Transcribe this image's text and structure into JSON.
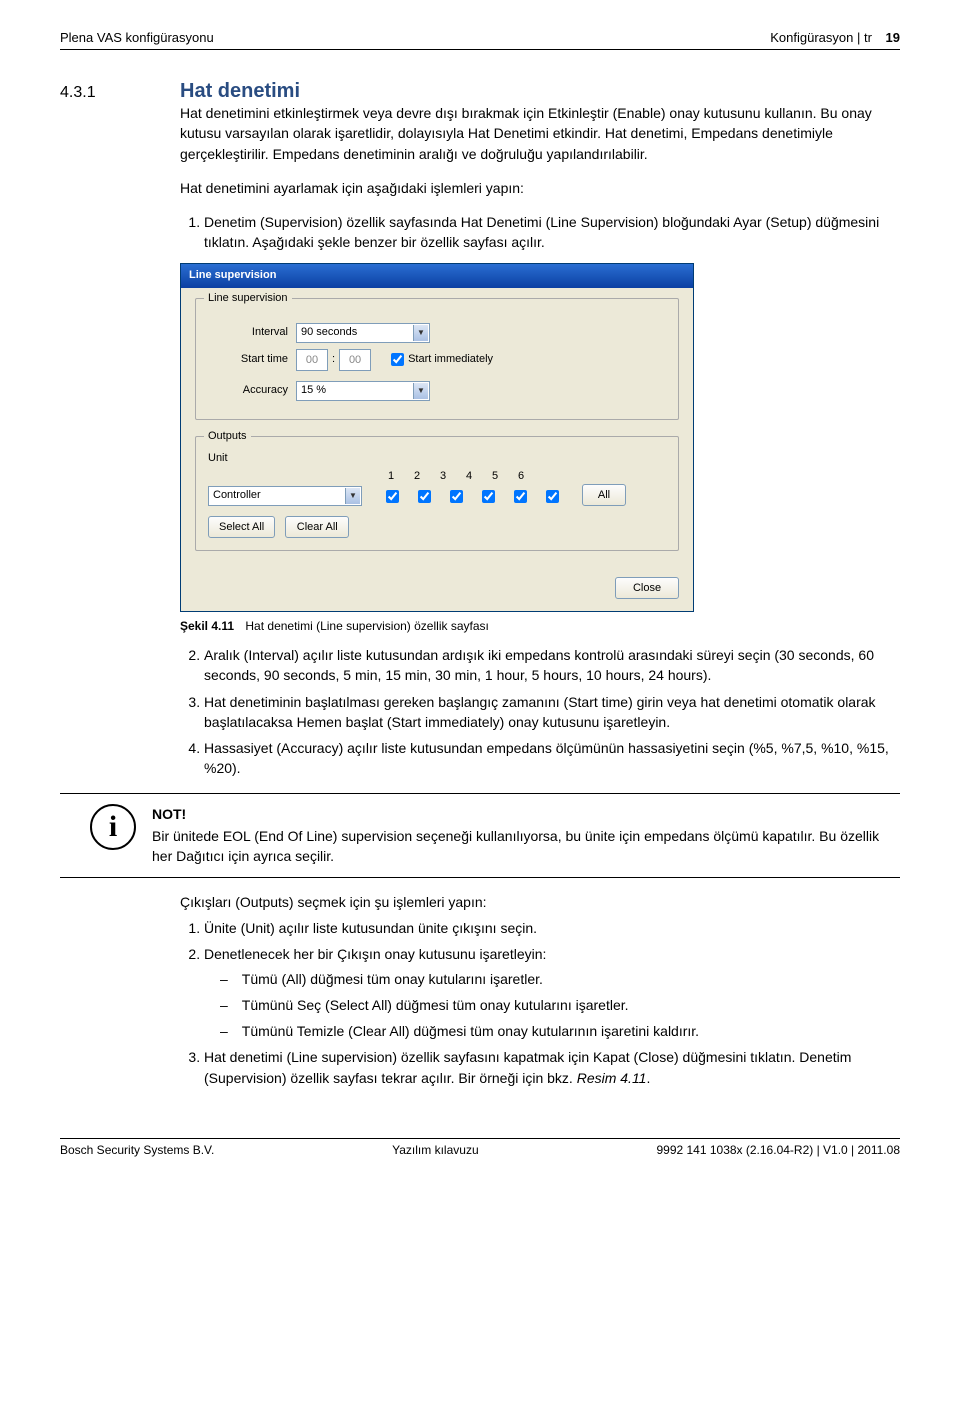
{
  "header": {
    "left": "Plena VAS konfigürasyonu",
    "right_label": "Konfigürasyon | tr",
    "page_number": "19"
  },
  "section": {
    "number": "4.3.1",
    "title": "Hat denetimi",
    "para1": "Hat denetimini etkinleştirmek veya devre dışı bırakmak için Etkinleştir (Enable) onay kutusunu kullanın. Bu onay kutusu varsayılan olarak işaretlidir, dolayısıyla Hat Denetimi etkindir. Hat denetimi, Empedans denetimiyle gerçekleştirilir. Empedans denetiminin aralığı ve doğruluğu yapılandırılabilir.",
    "para2": "Hat denetimini ayarlamak için aşağıdaki işlemleri yapın:",
    "li1": "Denetim (Supervision) özellik sayfasında Hat Denetimi (Line Supervision) bloğundaki Ayar (Setup) düğmesini tıklatın. Aşağıdaki şekle benzer bir özellik sayfası açılır."
  },
  "dialog": {
    "title": "Line supervision",
    "grp1": "Line supervision",
    "interval_label": "Interval",
    "interval_value": "90 seconds",
    "start_time_label": "Start time",
    "start_hh": "00",
    "start_mm": "00",
    "start_colon": ":",
    "start_imm_label": "Start immediately",
    "accuracy_label": "Accuracy",
    "accuracy_value": "15 %",
    "grp2": "Outputs",
    "unit_label": "Unit",
    "unit_value": "Controller",
    "nums": [
      "1",
      "2",
      "3",
      "4",
      "5",
      "6"
    ],
    "all_btn": "All",
    "select_all": "Select All",
    "clear_all": "Clear All",
    "close_btn": "Close"
  },
  "caption": {
    "label": "Şekil 4.11",
    "text": "Hat denetimi (Line supervision) özellik sayfası"
  },
  "list2": {
    "li2": "Aralık (Interval) açılır liste kutusundan ardışık iki empedans kontrolü arasındaki süreyi seçin (30 seconds, 60 seconds, 90 seconds, 5 min, 15 min, 30 min, 1 hour, 5 hours, 10 hours, 24 hours).",
    "li3": "Hat denetiminin başlatılması gereken başlangıç zamanını (Start time) girin veya hat denetimi otomatik olarak başlatılacaksa Hemen başlat (Start immediately) onay kutusunu işaretleyin.",
    "li4": "Hassasiyet (Accuracy) açılır liste kutusundan empedans ölçümünün hassasiyetini seçin (%5, %7,5, %10, %15, %20)."
  },
  "note": {
    "icon": "i",
    "heading": "NOT!",
    "text": "Bir ünitede EOL (End Of Line) supervision seçeneği kullanılıyorsa, bu ünite için empedans ölçümü kapatılır. Bu özellik her Dağıtıcı için ayrıca seçilir."
  },
  "outputs_section": {
    "intro": "Çıkışları (Outputs) seçmek için şu işlemleri yapın:",
    "li1": "Ünite (Unit) açılır liste kutusundan ünite çıkışını seçin.",
    "li2": "Denetlenecek her bir Çıkışın onay kutusunu işaretleyin:",
    "d1": "Tümü (All) düğmesi tüm onay kutularını işaretler.",
    "d2": "Tümünü Seç (Select All) düğmesi tüm onay kutularını işaretler.",
    "d3": "Tümünü Temizle (Clear All) düğmesi tüm onay kutularının işaretini kaldırır.",
    "li3a": "Hat denetimi (Line supervision) özellik sayfasını kapatmak için Kapat (Close) düğmesini tıklatın. Denetim (Supervision) özellik sayfası tekrar açılır. Bir örneği için bkz. ",
    "li3b": "Resim 4.11",
    "li3c": "."
  },
  "footer": {
    "left": "Bosch Security Systems B.V.",
    "center": "Yazılım kılavuzu",
    "right": "9992 141 1038x  (2.16.04-R2) | V1.0 | 2011.08"
  }
}
